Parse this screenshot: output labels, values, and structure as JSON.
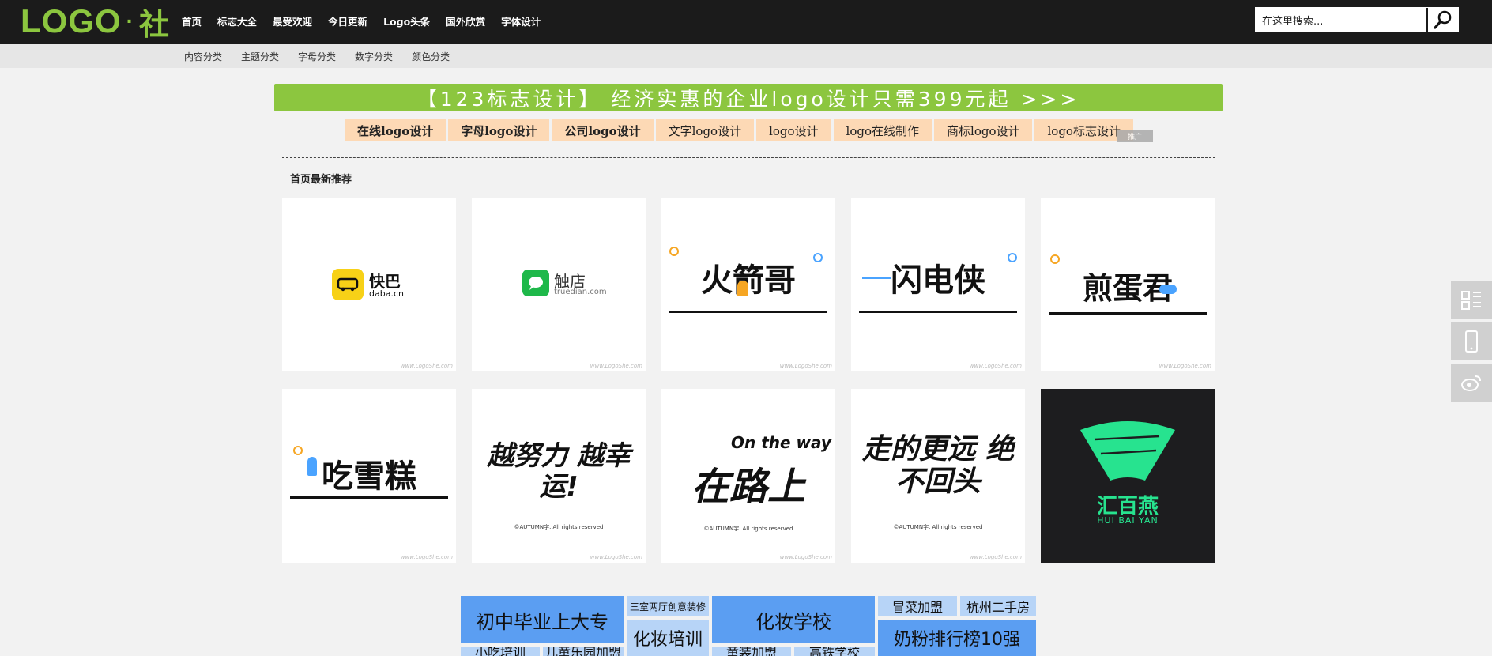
{
  "header": {
    "logo": {
      "text": "LOGO",
      "dot": "·",
      "she": "社"
    },
    "nav": [
      "首页",
      "标志大全",
      "最受欢迎",
      "今日更新",
      "Logo头条",
      "国外欣赏",
      "字体设计"
    ],
    "search": {
      "value": "在这里搜索..."
    }
  },
  "subnav": [
    "内容分类",
    "主题分类",
    "字母分类",
    "数字分类",
    "颜色分类"
  ],
  "banner": {
    "text": "【123标志设计】 经济实惠的企业logo设计只需399元起 >>>"
  },
  "tags": [
    {
      "label": "在线logo设计",
      "bold": true
    },
    {
      "label": "字母logo设计",
      "bold": true
    },
    {
      "label": "公司logo设计",
      "bold": true
    },
    {
      "label": "文字logo设计",
      "bold": false
    },
    {
      "label": "logo设计",
      "bold": false
    },
    {
      "label": "logo在线制作",
      "bold": false
    },
    {
      "label": "商标logo设计",
      "bold": false
    },
    {
      "label": "logo标志设计",
      "bold": false
    }
  ],
  "ad_badge": "推广",
  "section": {
    "title": "首页最新推荐"
  },
  "watermark": "www.LogoShe.com",
  "cards": [
    {
      "name": "快巴",
      "sub": "daba.cn"
    },
    {
      "name": "触店",
      "sub": "truedian.com"
    },
    {
      "name": "火箭哥"
    },
    {
      "name": "闪电侠"
    },
    {
      "name": "煎蛋君"
    },
    {
      "name": "吃雪糕"
    },
    {
      "name": "越努力 越幸运!",
      "credit": "©AUTUMN字. All rights reserved"
    },
    {
      "name": "在路上",
      "overlay": "On the way",
      "credit": "©AUTUMN字. All rights reserved"
    },
    {
      "name": "走的更远 绝不回头",
      "credit": "©AUTUMN字. All rights reserved"
    },
    {
      "name": "汇百燕",
      "sub": "HUI BAI YAN"
    }
  ],
  "ads": {
    "a1": "初中毕业上大专",
    "a2": "三室两厅创意装修",
    "a3": "化妆学校",
    "a4": "冒菜加盟",
    "a5": "杭州二手房",
    "a6": "化妆培训",
    "a7": "奶粉排行榜10强",
    "a8": "小吃培训",
    "a9": "儿童乐园加盟",
    "a10": "童装加盟",
    "a11": "高铁学校"
  },
  "colors": {
    "brand_green": "#8cc63f",
    "topbar": "#1b1b1b",
    "tag_bg": "#fdd9b5",
    "ad_blue": "#5b9ef2",
    "ad_light": "#b7d4f7"
  }
}
